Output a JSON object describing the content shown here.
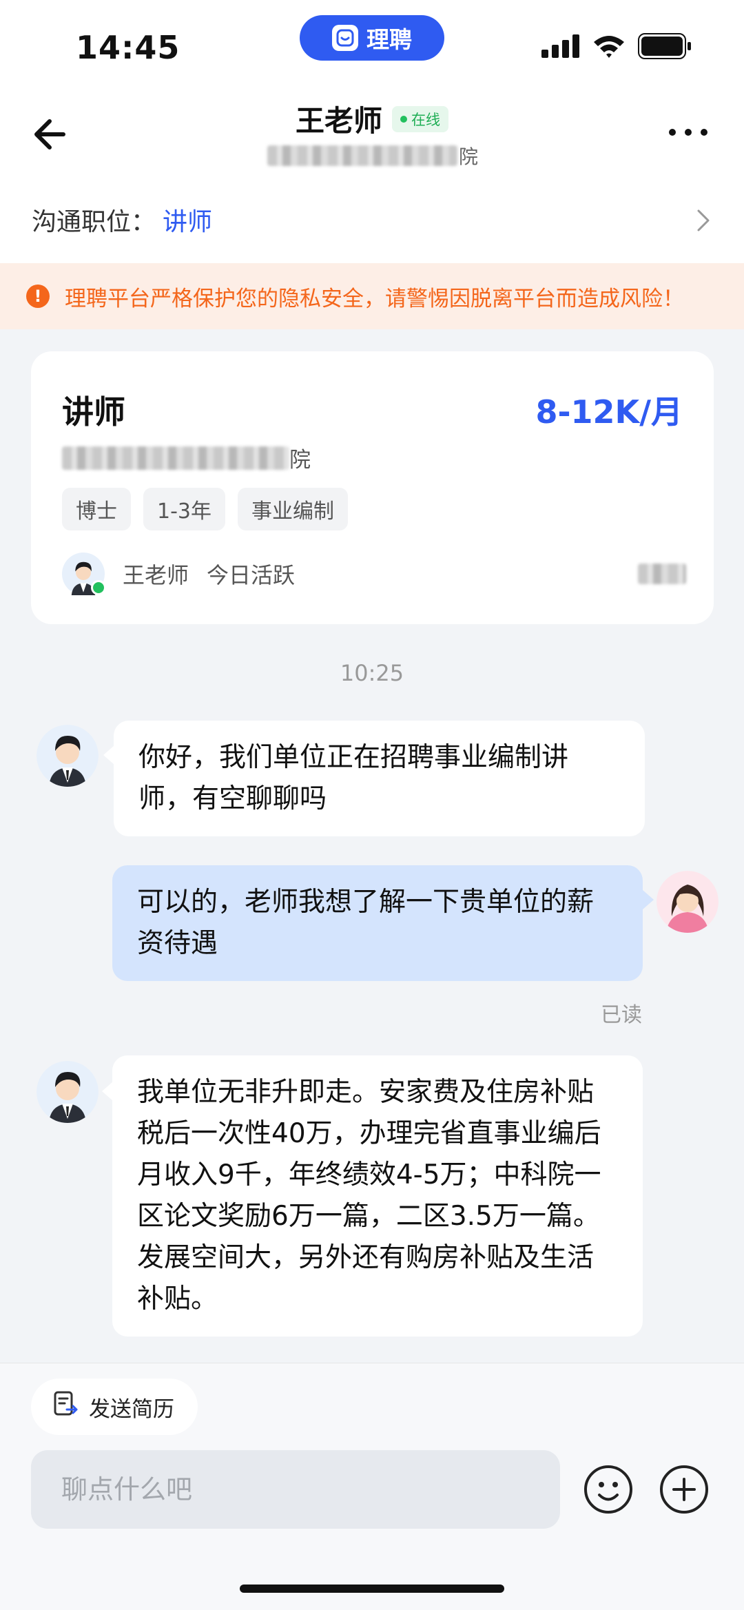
{
  "status_bar": {
    "time": "14:45",
    "app_pill": "理聘"
  },
  "header": {
    "name": "王老师",
    "online": "在线",
    "org_tail": "院"
  },
  "job_row": {
    "label": "沟通职位：",
    "value": "讲师"
  },
  "warning": {
    "text": "理聘平台严格保护您的隐私安全，请警惕因脱离平台而造成风险！"
  },
  "job_card": {
    "title": "讲师",
    "salary": "8-12K/月",
    "org_tail": "院",
    "tags": [
      "博士",
      "1-3年",
      "事业编制"
    ],
    "recruiter": "王老师",
    "activity": "今日活跃"
  },
  "chat": {
    "timestamp": "10:25",
    "messages": [
      {
        "from": "recruiter",
        "text": "你好，我们单位正在招聘事业编制讲师，有空聊聊吗"
      },
      {
        "from": "me",
        "text": "可以的，老师我想了解一下贵单位的薪资待遇"
      },
      {
        "from": "recruiter",
        "text": "我单位无非升即走。安家费及住房补贴税后一次性40万，办理完省直事业编后月收入9千，年终绩效4-5万；中科院一区论文奖励6万一篇，二区3.5万一篇。发展空间大，另外还有购房补贴及生活补贴。"
      }
    ],
    "read_status": "已读"
  },
  "bottom": {
    "send_resume": "发送简历",
    "input_placeholder": "聊点什么吧"
  },
  "colors": {
    "accent": "#2f5bf1",
    "warning": "#f4661b",
    "online": "#22c05e",
    "my_bubble": "#d4e4fd"
  },
  "icons": [
    "back-arrow-icon",
    "more-icon",
    "chevron-right-icon",
    "warning-icon",
    "resume-icon",
    "emoji-icon",
    "plus-icon"
  ]
}
